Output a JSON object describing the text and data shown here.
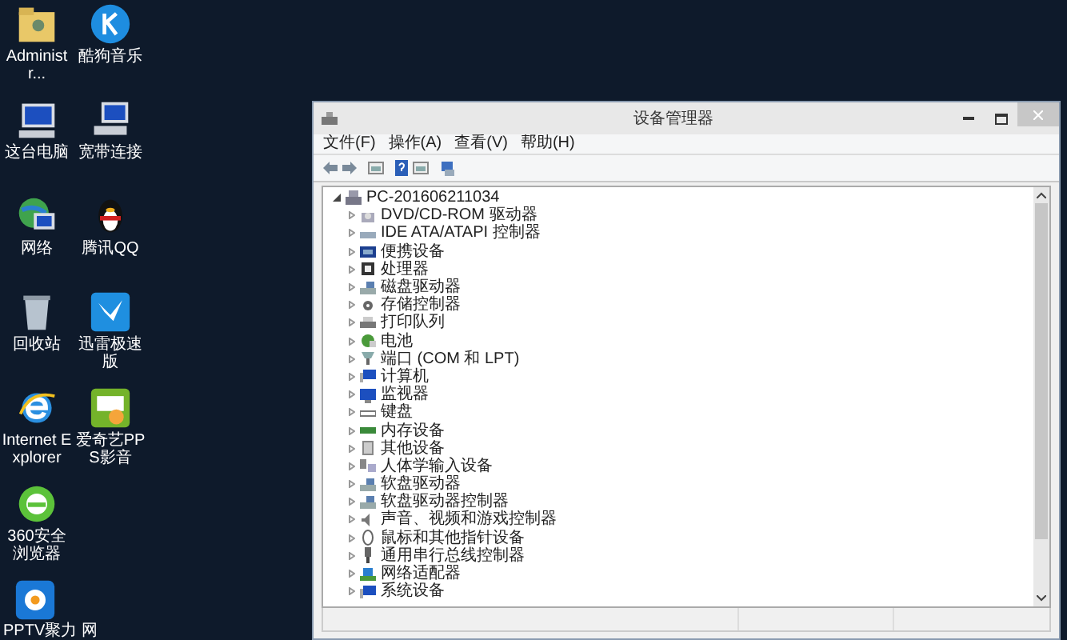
{
  "desktop_icons": [
    {
      "label": "Administr...",
      "kind": "folder"
    },
    {
      "label": "酷狗音乐",
      "kind": "music"
    },
    {
      "label": "这台电脑",
      "kind": "computer"
    },
    {
      "label": "宽带连接",
      "kind": "network"
    },
    {
      "label": "网络",
      "kind": "globe"
    },
    {
      "label": "腾讯QQ",
      "kind": "penguin"
    },
    {
      "label": "回收站",
      "kind": "bin"
    },
    {
      "label": "迅雷极速版",
      "kind": "bird"
    },
    {
      "label": "Internet Explorer",
      "kind": "ie"
    },
    {
      "label": "爱奇艺PPS影音",
      "kind": "tv"
    },
    {
      "label": "360安全浏览器",
      "kind": "browser360"
    },
    {
      "label": "PPTV聚力 网",
      "kind": "pptv"
    }
  ],
  "window": {
    "title": "设备管理器",
    "menu": [
      "文件(F)",
      "操作(A)",
      "查看(V)",
      "帮助(H)"
    ],
    "tree": {
      "label": "PC-201606211034",
      "expanded": true,
      "children": [
        {
          "label": "DVD/CD-ROM 驱动器",
          "kind": "disc"
        },
        {
          "label": "IDE ATA/ATAPI 控制器",
          "kind": "controller"
        },
        {
          "label": "便携设备",
          "kind": "portable"
        },
        {
          "label": "处理器",
          "kind": "cpu"
        },
        {
          "label": "磁盘驱动器",
          "kind": "disk"
        },
        {
          "label": "存储控制器",
          "kind": "storage"
        },
        {
          "label": "打印队列",
          "kind": "printer"
        },
        {
          "label": "电池",
          "kind": "battery"
        },
        {
          "label": "端口 (COM 和 LPT)",
          "kind": "port"
        },
        {
          "label": "计算机",
          "kind": "computer"
        },
        {
          "label": "监视器",
          "kind": "monitor"
        },
        {
          "label": "键盘",
          "kind": "keyboard"
        },
        {
          "label": "内存设备",
          "kind": "memory"
        },
        {
          "label": "其他设备",
          "kind": "other"
        },
        {
          "label": "人体学输入设备",
          "kind": "hid"
        },
        {
          "label": "软盘驱动器",
          "kind": "disk"
        },
        {
          "label": "软盘驱动器控制器",
          "kind": "disk"
        },
        {
          "label": "声音、视频和游戏控制器",
          "kind": "sound"
        },
        {
          "label": "鼠标和其他指针设备",
          "kind": "mouse"
        },
        {
          "label": "通用串行总线控制器",
          "kind": "usb"
        },
        {
          "label": "网络适配器",
          "kind": "network"
        },
        {
          "label": "系统设备",
          "kind": "computer"
        }
      ]
    }
  }
}
